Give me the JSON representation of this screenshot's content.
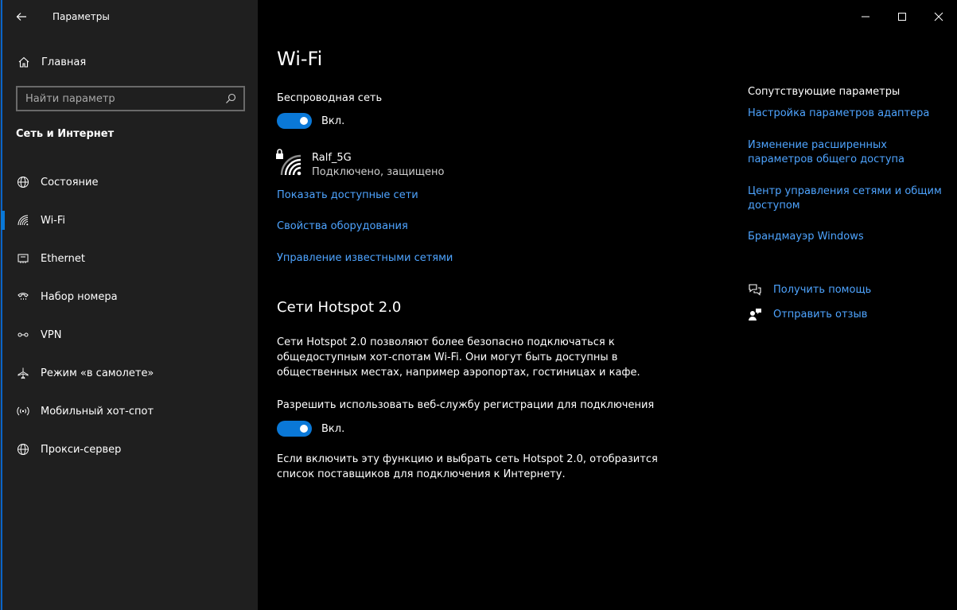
{
  "window": {
    "app_title": "Параметры"
  },
  "sidebar": {
    "home_label": "Главная",
    "search_placeholder": "Найти параметр",
    "section_label": "Сеть и Интернет",
    "items": [
      {
        "label": "Состояние",
        "icon": "globe-icon"
      },
      {
        "label": "Wi-Fi",
        "icon": "wifi-icon",
        "active": true
      },
      {
        "label": "Ethernet",
        "icon": "ethernet-icon"
      },
      {
        "label": "Набор номера",
        "icon": "dialup-icon"
      },
      {
        "label": "VPN",
        "icon": "vpn-icon"
      },
      {
        "label": "Режим «в самолете»",
        "icon": "airplane-icon"
      },
      {
        "label": "Мобильный хот-спот",
        "icon": "hotspot-icon"
      },
      {
        "label": "Прокси-сервер",
        "icon": "globe-icon"
      }
    ]
  },
  "main": {
    "title": "Wi-Fi",
    "wireless_label": "Беспроводная сеть",
    "wireless_toggle_state": "Вкл.",
    "network": {
      "name": "Ralf_5G",
      "status": "Подключено, защищено"
    },
    "links": [
      "Показать доступные сети",
      "Свойства оборудования",
      "Управление известными сетями"
    ],
    "hotspot": {
      "heading": "Сети Hotspot 2.0",
      "description_lines": [
        "Сети Hotspot 2.0 позволяют более безопасно подключаться к",
        "общедоступным хот-спотам Wi-Fi. Они могут быть доступны в",
        "общественных местах, например аэропортах, гостиницах и кафе."
      ],
      "allow_label": "Разрешить использовать веб-службу регистрации для подключения",
      "toggle_state": "Вкл.",
      "note_lines": [
        "Если включить эту функцию и выбрать сеть Hotspot 2.0, отобразится",
        "список поставщиков для подключения к Интернету."
      ]
    }
  },
  "related": {
    "title": "Сопутствующие параметры",
    "links": [
      [
        "Настройка параметров адаптера"
      ],
      [
        "Изменение расширенных",
        "параметров общего доступа"
      ],
      [
        "Центр управления сетями и общим",
        "доступом"
      ],
      [
        "Брандмауэр Windows"
      ]
    ],
    "help": "Получить помощь",
    "feedback": "Отправить отзыв"
  },
  "colors": {
    "accent": "#0a78d7",
    "link": "#4ea4ff",
    "sidebar_bg": "#1f1f1f",
    "main_bg": "#000000"
  }
}
